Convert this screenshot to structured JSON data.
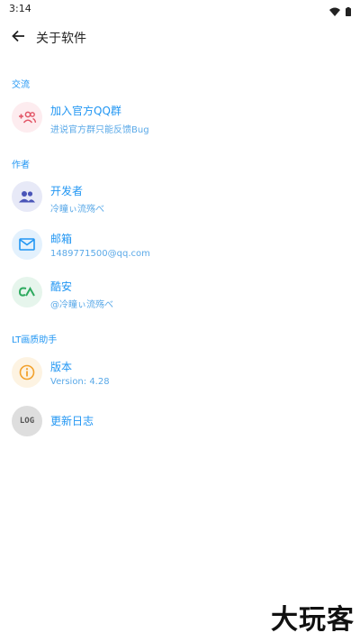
{
  "status_bar": {
    "time": "3:14"
  },
  "toolbar": {
    "title": "关于软件"
  },
  "sections": {
    "communication": "交流",
    "author": "作者",
    "app": "LT画质助手"
  },
  "items": {
    "join_group": {
      "title": "加入官方QQ群",
      "subtitle": "进说官方群只能反馈Bug",
      "icon": "group-add-icon",
      "icon_color": "#e25566",
      "bg": "#fdecef"
    },
    "developer": {
      "title": "开发者",
      "subtitle": "冷瞳ぃ流殇べ",
      "icon": "people-icon",
      "icon_color": "#4a55b8",
      "bg": "#e7e9f7"
    },
    "email": {
      "title": "邮箱",
      "subtitle": "1489771500@qq.com",
      "icon": "mail-icon",
      "icon_color": "#2196f3",
      "bg": "#e3f1fd"
    },
    "coolapk": {
      "title": "酷安",
      "subtitle": "@冷瞳ぃ流殇べ",
      "icon": "coolapk-icon",
      "icon_color": "#2eaa5f",
      "bg": "#e6f5ec"
    },
    "version": {
      "title": "版本",
      "subtitle": "Version: 4.28",
      "icon": "info-icon",
      "icon_color": "#f2a12c",
      "bg": "#fdf3e2"
    },
    "changelog": {
      "title": "更新日志",
      "icon": "log-icon",
      "icon_color": "#555555",
      "bg": "#dedede",
      "icon_text": "LOG"
    }
  },
  "watermark": "大玩客"
}
